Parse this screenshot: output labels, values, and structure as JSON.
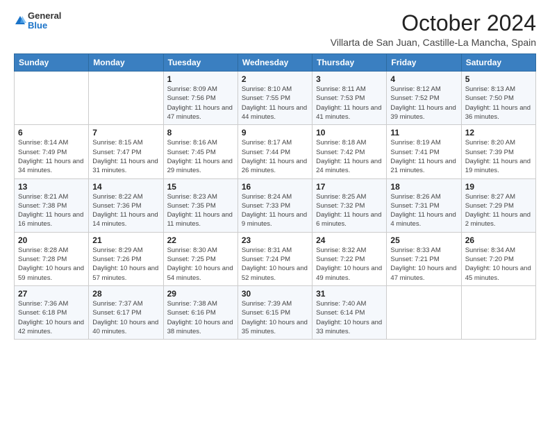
{
  "logo": {
    "line1": "General",
    "line2": "Blue"
  },
  "header": {
    "month": "October 2024",
    "subtitle": "Villarta de San Juan, Castille-La Mancha, Spain"
  },
  "days_of_week": [
    "Sunday",
    "Monday",
    "Tuesday",
    "Wednesday",
    "Thursday",
    "Friday",
    "Saturday"
  ],
  "weeks": [
    [
      {
        "day": "",
        "info": ""
      },
      {
        "day": "",
        "info": ""
      },
      {
        "day": "1",
        "info": "Sunrise: 8:09 AM\nSunset: 7:56 PM\nDaylight: 11 hours and 47 minutes."
      },
      {
        "day": "2",
        "info": "Sunrise: 8:10 AM\nSunset: 7:55 PM\nDaylight: 11 hours and 44 minutes."
      },
      {
        "day": "3",
        "info": "Sunrise: 8:11 AM\nSunset: 7:53 PM\nDaylight: 11 hours and 41 minutes."
      },
      {
        "day": "4",
        "info": "Sunrise: 8:12 AM\nSunset: 7:52 PM\nDaylight: 11 hours and 39 minutes."
      },
      {
        "day": "5",
        "info": "Sunrise: 8:13 AM\nSunset: 7:50 PM\nDaylight: 11 hours and 36 minutes."
      }
    ],
    [
      {
        "day": "6",
        "info": "Sunrise: 8:14 AM\nSunset: 7:49 PM\nDaylight: 11 hours and 34 minutes."
      },
      {
        "day": "7",
        "info": "Sunrise: 8:15 AM\nSunset: 7:47 PM\nDaylight: 11 hours and 31 minutes."
      },
      {
        "day": "8",
        "info": "Sunrise: 8:16 AM\nSunset: 7:45 PM\nDaylight: 11 hours and 29 minutes."
      },
      {
        "day": "9",
        "info": "Sunrise: 8:17 AM\nSunset: 7:44 PM\nDaylight: 11 hours and 26 minutes."
      },
      {
        "day": "10",
        "info": "Sunrise: 8:18 AM\nSunset: 7:42 PM\nDaylight: 11 hours and 24 minutes."
      },
      {
        "day": "11",
        "info": "Sunrise: 8:19 AM\nSunset: 7:41 PM\nDaylight: 11 hours and 21 minutes."
      },
      {
        "day": "12",
        "info": "Sunrise: 8:20 AM\nSunset: 7:39 PM\nDaylight: 11 hours and 19 minutes."
      }
    ],
    [
      {
        "day": "13",
        "info": "Sunrise: 8:21 AM\nSunset: 7:38 PM\nDaylight: 11 hours and 16 minutes."
      },
      {
        "day": "14",
        "info": "Sunrise: 8:22 AM\nSunset: 7:36 PM\nDaylight: 11 hours and 14 minutes."
      },
      {
        "day": "15",
        "info": "Sunrise: 8:23 AM\nSunset: 7:35 PM\nDaylight: 11 hours and 11 minutes."
      },
      {
        "day": "16",
        "info": "Sunrise: 8:24 AM\nSunset: 7:33 PM\nDaylight: 11 hours and 9 minutes."
      },
      {
        "day": "17",
        "info": "Sunrise: 8:25 AM\nSunset: 7:32 PM\nDaylight: 11 hours and 6 minutes."
      },
      {
        "day": "18",
        "info": "Sunrise: 8:26 AM\nSunset: 7:31 PM\nDaylight: 11 hours and 4 minutes."
      },
      {
        "day": "19",
        "info": "Sunrise: 8:27 AM\nSunset: 7:29 PM\nDaylight: 11 hours and 2 minutes."
      }
    ],
    [
      {
        "day": "20",
        "info": "Sunrise: 8:28 AM\nSunset: 7:28 PM\nDaylight: 10 hours and 59 minutes."
      },
      {
        "day": "21",
        "info": "Sunrise: 8:29 AM\nSunset: 7:26 PM\nDaylight: 10 hours and 57 minutes."
      },
      {
        "day": "22",
        "info": "Sunrise: 8:30 AM\nSunset: 7:25 PM\nDaylight: 10 hours and 54 minutes."
      },
      {
        "day": "23",
        "info": "Sunrise: 8:31 AM\nSunset: 7:24 PM\nDaylight: 10 hours and 52 minutes."
      },
      {
        "day": "24",
        "info": "Sunrise: 8:32 AM\nSunset: 7:22 PM\nDaylight: 10 hours and 49 minutes."
      },
      {
        "day": "25",
        "info": "Sunrise: 8:33 AM\nSunset: 7:21 PM\nDaylight: 10 hours and 47 minutes."
      },
      {
        "day": "26",
        "info": "Sunrise: 8:34 AM\nSunset: 7:20 PM\nDaylight: 10 hours and 45 minutes."
      }
    ],
    [
      {
        "day": "27",
        "info": "Sunrise: 7:36 AM\nSunset: 6:18 PM\nDaylight: 10 hours and 42 minutes."
      },
      {
        "day": "28",
        "info": "Sunrise: 7:37 AM\nSunset: 6:17 PM\nDaylight: 10 hours and 40 minutes."
      },
      {
        "day": "29",
        "info": "Sunrise: 7:38 AM\nSunset: 6:16 PM\nDaylight: 10 hours and 38 minutes."
      },
      {
        "day": "30",
        "info": "Sunrise: 7:39 AM\nSunset: 6:15 PM\nDaylight: 10 hours and 35 minutes."
      },
      {
        "day": "31",
        "info": "Sunrise: 7:40 AM\nSunset: 6:14 PM\nDaylight: 10 hours and 33 minutes."
      },
      {
        "day": "",
        "info": ""
      },
      {
        "day": "",
        "info": ""
      }
    ]
  ]
}
